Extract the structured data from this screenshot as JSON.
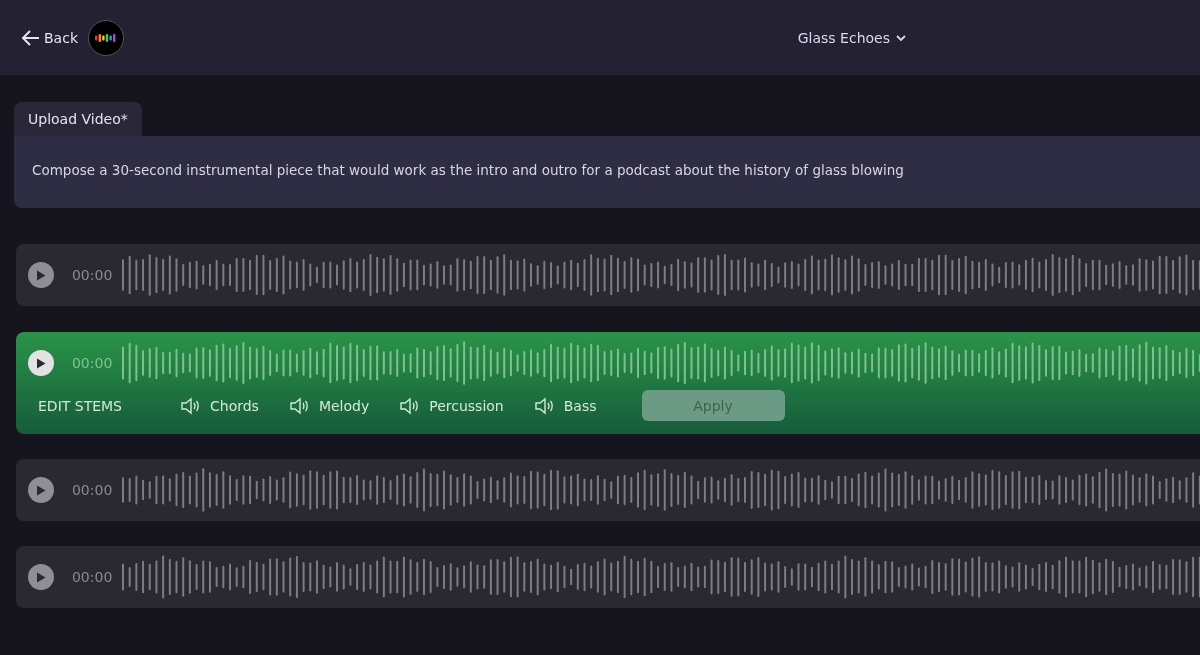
{
  "header": {
    "back_label": "Back",
    "project_title": "Glass Echoes"
  },
  "upload_tab": {
    "label": "Upload Video*"
  },
  "prompt": {
    "text": "Compose a 30-second instrumental piece that would work as the intro and outro for a podcast about the history of glass blowing"
  },
  "tracks": [
    {
      "time": "00:00",
      "selected": false
    },
    {
      "time": "00:00",
      "selected": true
    },
    {
      "time": "00:00",
      "selected": false
    },
    {
      "time": "00:00",
      "selected": false
    }
  ],
  "stems": {
    "label": "EDIT STEMS",
    "items": [
      "Chords",
      "Melody",
      "Percussion",
      "Bass"
    ],
    "apply": {
      "label": "Apply",
      "disabled": true
    }
  }
}
